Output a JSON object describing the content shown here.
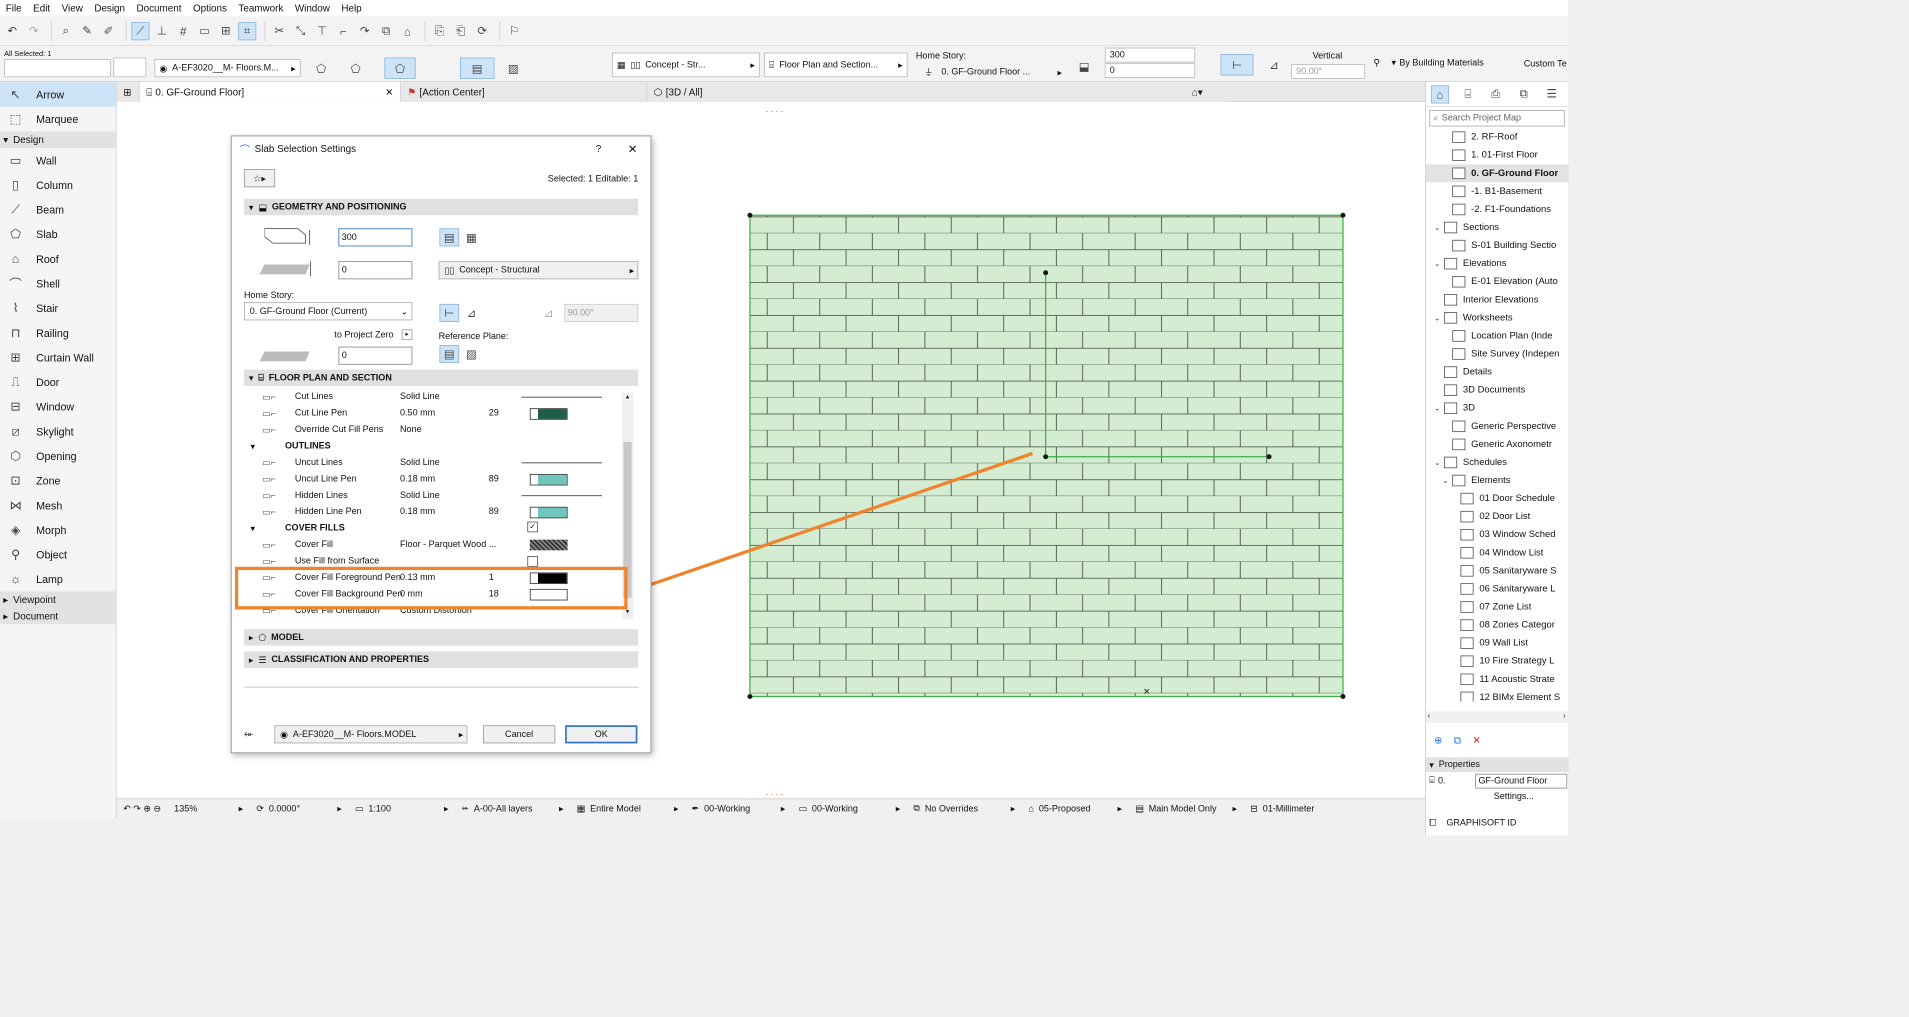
{
  "menu": [
    "File",
    "Edit",
    "View",
    "Design",
    "Document",
    "Options",
    "Teamwork",
    "Window",
    "Help"
  ],
  "info_box": {
    "all_selected": "All Selected: 1",
    "layer": "A-EF3020__M- Floors.M...",
    "structure": "Concept - Str...",
    "floor_plan": "Floor Plan and Section...",
    "home_story_label": "Home Story:",
    "home_story": "0. GF-Ground Floor ...",
    "thickness": "300",
    "offset": "0",
    "vertical": "Vertical",
    "angle": "90.00°",
    "material": "By Building Materials",
    "custom": "Custom Te"
  },
  "toolbox": {
    "arrow": "Arrow",
    "marquee": "Marquee",
    "design": "Design",
    "tools": [
      "Wall",
      "Column",
      "Beam",
      "Slab",
      "Roof",
      "Shell",
      "Stair",
      "Railing",
      "Curtain Wall",
      "Door",
      "Window",
      "Skylight",
      "Opening",
      "Zone",
      "Mesh",
      "Morph",
      "Object",
      "Lamp"
    ],
    "viewpoint": "Viewpoint",
    "document": "Document"
  },
  "tabs": [
    "0. GF-Ground Floor]",
    "[Action Center]",
    "[3D / All]"
  ],
  "dialog": {
    "title": "Slab Selection Settings",
    "help": "?",
    "selected": "Selected: 1 Editable: 1",
    "geom_title": "GEOMETRY AND POSITIONING",
    "thickness": "300",
    "offset": "0",
    "home_story_label": "Home Story:",
    "home_story": "0. GF-Ground Floor (Current)",
    "structure": "Concept - Structural",
    "angle": "90.00°",
    "to_project_zero": "to Project Zero",
    "zero_value": "0",
    "reference_plane": "Reference Plane:",
    "fps_title": "FLOOR PLAN AND SECTION",
    "rows": [
      {
        "n": "Cut Lines",
        "v": "Solid Line",
        "p": ""
      },
      {
        "n": "Cut Line Pen",
        "v": "0.50 mm",
        "p": "29"
      },
      {
        "n": "Override Cut Fill Pens",
        "v": "None",
        "p": ""
      },
      {
        "n": "OUTLINES",
        "v": "",
        "p": ""
      },
      {
        "n": "Uncut Lines",
        "v": "Solid Line",
        "p": ""
      },
      {
        "n": "Uncut Line Pen",
        "v": "0.18 mm",
        "p": "89"
      },
      {
        "n": "Hidden Lines",
        "v": "Solid Line",
        "p": ""
      },
      {
        "n": "Hidden Line Pen",
        "v": "0.18 mm",
        "p": "89"
      },
      {
        "n": "COVER FILLS",
        "v": "",
        "p": ""
      },
      {
        "n": "Cover Fill",
        "v": "Floor - Parquet Wood ...",
        "p": ""
      },
      {
        "n": "Use Fill from Surface",
        "v": "",
        "p": ""
      },
      {
        "n": "Cover Fill Foreground Pen",
        "v": "0.13 mm",
        "p": "1"
      },
      {
        "n": "Cover Fill Background Pen",
        "v": "0 mm",
        "p": "18"
      },
      {
        "n": "Cover Fill Orientation",
        "v": "Custom Distortion",
        "p": ""
      }
    ],
    "model_title": "MODEL",
    "class_title": "CLASSIFICATION AND PROPERTIES",
    "layer": "A-EF3020__M- Floors.MODEL",
    "cancel": "Cancel",
    "ok": "OK"
  },
  "navigator": {
    "search": "Search Project Map",
    "items": [
      {
        "t": "2. RF-Roof",
        "i": 2
      },
      {
        "t": "1. 01-First Floor",
        "i": 2
      },
      {
        "t": "0. GF-Ground Floor",
        "i": 2,
        "sel": true
      },
      {
        "t": "-1. B1-Basement",
        "i": 2
      },
      {
        "t": "-2. F1-Foundations",
        "i": 2
      },
      {
        "t": "Sections",
        "i": 1,
        "a": "open"
      },
      {
        "t": "S-01 Building Sectio",
        "i": 2
      },
      {
        "t": "Elevations",
        "i": 1,
        "a": "open"
      },
      {
        "t": "E-01 Elevation (Auto",
        "i": 2
      },
      {
        "t": "Interior Elevations",
        "i": 1
      },
      {
        "t": "Worksheets",
        "i": 1,
        "a": "open"
      },
      {
        "t": "Location Plan (Inde",
        "i": 2
      },
      {
        "t": "Site Survey (Indepen",
        "i": 2
      },
      {
        "t": "Details",
        "i": 1
      },
      {
        "t": "3D Documents",
        "i": 1
      },
      {
        "t": "3D",
        "i": 1,
        "a": "open"
      },
      {
        "t": "Generic Perspective",
        "i": 2
      },
      {
        "t": "Generic Axonometr",
        "i": 2
      },
      {
        "t": "Schedules",
        "i": 1,
        "a": "open"
      },
      {
        "t": "Elements",
        "i": 2,
        "a": "open"
      },
      {
        "t": "01 Door Schedule",
        "i": 3
      },
      {
        "t": "02 Door List",
        "i": 3
      },
      {
        "t": "03 Window Sched",
        "i": 3
      },
      {
        "t": "04 Window List",
        "i": 3
      },
      {
        "t": "05 Sanitaryware S",
        "i": 3
      },
      {
        "t": "06 Sanitaryware L",
        "i": 3
      },
      {
        "t": "07 Zone List",
        "i": 3
      },
      {
        "t": "08 Zones Categor",
        "i": 3
      },
      {
        "t": "09 Wall List",
        "i": 3
      },
      {
        "t": "10 Fire Strategy L",
        "i": 3
      },
      {
        "t": "11 Acoustic Strate",
        "i": 3
      },
      {
        "t": "12 BIMx Element S",
        "i": 3
      }
    ],
    "properties": "Properties",
    "prop_id": "0.",
    "prop_name": "GF-Ground Floor",
    "settings": "Settings...",
    "brand": "GRAPHISOFT ID"
  },
  "status": {
    "zoom": "135%",
    "angle": "0.0000°",
    "scale": "1:100",
    "layers": "A-00-All layers",
    "model": "Entire Model",
    "pen": "00-Working",
    "view": "00-Working",
    "override": "No Overrides",
    "reno": "05-Proposed",
    "main": "Main Model Only",
    "dim": "01-Millimeter"
  },
  "colors": {
    "accent": "#cde3f7",
    "highlight": "#f0842c",
    "slab_fill": "#d4ecd2",
    "slab_stroke": "#3cb043"
  }
}
